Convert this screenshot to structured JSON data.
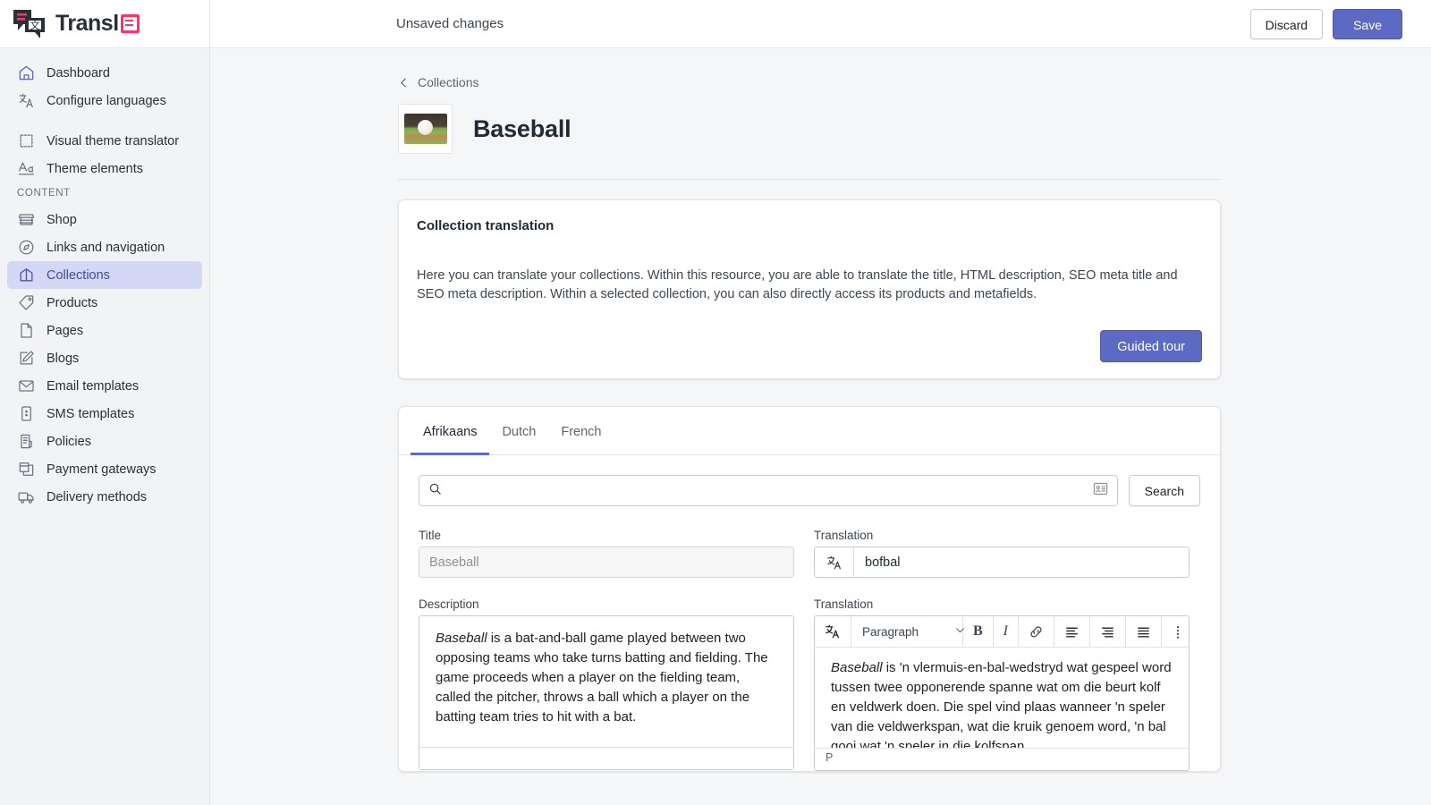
{
  "brand": {
    "name": "Transl",
    "badge_icon": "text-box-icon",
    "accent": "#ff3366"
  },
  "topbar": {
    "status": "Unsaved changes",
    "discard_label": "Discard",
    "save_label": "Save",
    "primary_color": "#5c6ac4"
  },
  "sidebar": {
    "items_top": [
      {
        "label": "Dashboard",
        "icon": "home-icon"
      },
      {
        "label": "Configure languages",
        "icon": "translate-icon"
      }
    ],
    "items_mid": [
      {
        "label": "Visual theme translator",
        "icon": "theme-edit-icon"
      },
      {
        "label": "Theme elements",
        "icon": "typography-icon"
      }
    ],
    "section_label": "CONTENT",
    "items_content": [
      {
        "label": "Shop",
        "icon": "store-icon",
        "active": false
      },
      {
        "label": "Links and navigation",
        "icon": "compass-icon",
        "active": false
      },
      {
        "label": "Collections",
        "icon": "collection-icon",
        "active": true
      },
      {
        "label": "Products",
        "icon": "tag-icon",
        "active": false
      },
      {
        "label": "Pages",
        "icon": "page-icon",
        "active": false
      },
      {
        "label": "Blogs",
        "icon": "pencil-square-icon",
        "active": false
      },
      {
        "label": "Email templates",
        "icon": "envelope-icon",
        "active": false
      },
      {
        "label": "SMS templates",
        "icon": "phone-message-icon",
        "active": false
      },
      {
        "label": "Policies",
        "icon": "policy-document-icon",
        "active": false
      },
      {
        "label": "Payment gateways",
        "icon": "payment-card-icon",
        "active": false
      },
      {
        "label": "Delivery methods",
        "icon": "truck-icon",
        "active": false
      }
    ]
  },
  "page": {
    "breadcrumb": "Collections",
    "title": "Baseball",
    "thumbnail_alt": "baseball-on-field-thumbnail"
  },
  "info_card": {
    "heading": "Collection translation",
    "body": "Here you can translate your collections. Within this resource, you are able to translate the title, HTML description, SEO meta title and SEO meta description. Within a selected collection, you can also directly access its products and metafields.",
    "cta_label": "Guided tour"
  },
  "translation_card": {
    "tabs": [
      {
        "label": "Afrikaans",
        "active": true
      },
      {
        "label": "Dutch",
        "active": false
      },
      {
        "label": "French",
        "active": false
      }
    ],
    "search": {
      "value": "",
      "placeholder": "",
      "icon": "search-icon",
      "trailing_icon": "id-card-icon",
      "button_label": "Search"
    },
    "title_field": {
      "label": "Title",
      "value": "Baseball",
      "readonly": true
    },
    "title_translation": {
      "label": "Translation",
      "value": "bofbal",
      "prefix_icon": "translate-icon"
    },
    "description_field": {
      "label": "Description",
      "emphasis": "Baseball",
      "text": " is a bat-and-ball game played between two opposing teams who take turns batting and fielding. The game proceeds when a player on the fielding team, called the pitcher, throws a ball which a player on the batting team tries to hit with a bat.",
      "status": ""
    },
    "description_translation": {
      "label": "Translation",
      "emphasis": "Baseball",
      "text": " is 'n vlermuis-en-bal-wedstryd wat gespeel word tussen twee opponerende spanne wat om die beurt kolf en veldwerk doen. Die spel vind plaas wanneer 'n speler van die veldwerkspan, wat die kruik genoem word, 'n bal gooi wat 'n speler in die kolfspan",
      "status": "P",
      "toolbar": {
        "translate_icon": "translate-icon",
        "block_format": "Paragraph",
        "chevron_icon": "chevron-down-icon",
        "bold_label": "B",
        "italic_label": "I",
        "link_icon": "link-icon",
        "align_left_icon": "align-left-icon",
        "align_right_icon": "align-right-icon",
        "align_justify_icon": "align-justify-icon",
        "more_icon": "vertical-dots-icon"
      }
    }
  }
}
